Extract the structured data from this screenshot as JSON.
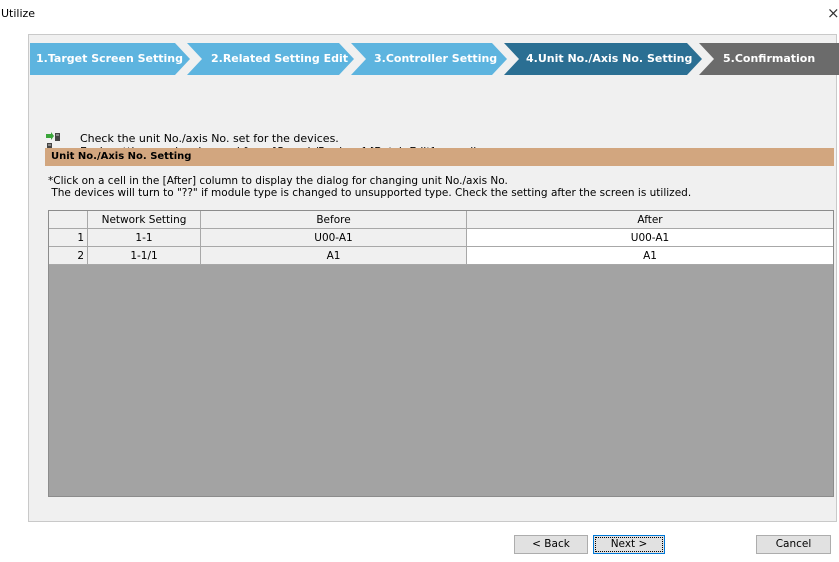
{
  "window": {
    "title": "Utilize",
    "close_glyph": "×"
  },
  "wizard_steps": [
    {
      "label": "1.Target Screen Setting",
      "state": "done"
    },
    {
      "label": "2.Related Setting Edit",
      "state": "done"
    },
    {
      "label": "3.Controller Setting",
      "state": "done"
    },
    {
      "label": "4.Unit No./Axis No. Setting",
      "state": "current"
    },
    {
      "label": "5.Confirmation",
      "state": "pending"
    }
  ],
  "info": {
    "icon": "device-settings-icon",
    "line1": "Check the unit No./axis No. set for the devices.",
    "line2": "Each setting can be changed from [Search/Replace]-[Batch Edit] as well."
  },
  "section": {
    "title": "Unit No./Axis No. Setting"
  },
  "note": {
    "line1": "*Click on a cell in the [After] column to display the dialog for changing unit No./axis No.",
    "line2": " The devices will turn to \"??\" if module type is changed to unsupported type. Check the setting after the screen is utilized."
  },
  "table": {
    "columns": [
      "",
      "Network Setting",
      "Before",
      "After"
    ],
    "rows": [
      {
        "num": "1",
        "network": "1-1",
        "before": "U00-A1",
        "after": "U00-A1"
      },
      {
        "num": "2",
        "network": "1-1/1",
        "before": "A1",
        "after": "A1"
      }
    ]
  },
  "buttons": {
    "back": "< Back",
    "next": "Next >",
    "cancel": "Cancel"
  },
  "colors": {
    "step_done": "#5db4df",
    "step_current": "#2b6f93",
    "step_pending": "#6b6b6b",
    "section_header": "#d2a67f",
    "grid_empty": "#a3a3a3"
  }
}
